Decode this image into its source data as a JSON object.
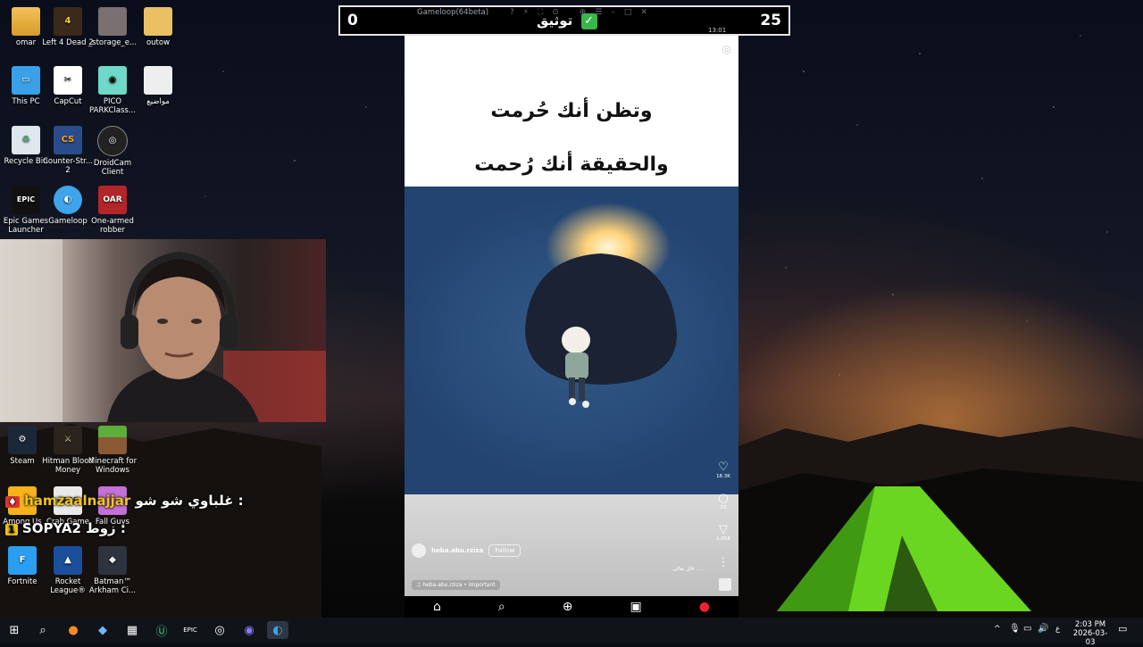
{
  "desktop": {
    "icons": [
      {
        "label": "omar"
      },
      {
        "label": "Left 4 Dead 2"
      },
      {
        "label": "_storage_e..."
      },
      {
        "label": "outow"
      },
      {
        "label": "This PC"
      },
      {
        "label": "CapCut"
      },
      {
        "label": "PICO PARKClass..."
      },
      {
        "label": "مواضيع"
      },
      {
        "label": "Recycle Bin"
      },
      {
        "label": "Counter-Str... 2"
      },
      {
        "label": "DroidCam Client"
      },
      {
        "label": "Epic Games Launcher"
      },
      {
        "label": "Gameloop"
      },
      {
        "label": "One-armed robber"
      },
      {
        "label": "Steam"
      },
      {
        "label": "Hitman Blood Money"
      },
      {
        "label": "Minecraft for Windows"
      },
      {
        "label": "Among Us"
      },
      {
        "label": "Crab Game"
      },
      {
        "label": "Fall Guys"
      },
      {
        "label": "Fortnite"
      },
      {
        "label": "Rocket League®"
      },
      {
        "label": "Batman™ Arkham Ci..."
      }
    ]
  },
  "chat": {
    "messages": [
      {
        "user": "hamzaalnajjar",
        "text": "غلباوي شو شو :"
      },
      {
        "user": "SOPYA2",
        "text": "زوط :"
      }
    ]
  },
  "overlay": {
    "score_left": "0",
    "score_right": "25",
    "center_text": "توثيق",
    "check": "✓",
    "emulator_title": "Gameloop(64beta)",
    "status_time": "13:01"
  },
  "post": {
    "caption_line1": "وتظن أنك حُرمت",
    "caption_line2": "والحقيقة أنك رُحمت",
    "likes": "18.3K",
    "comments": "33",
    "shares": "1,658",
    "username": "heba.abu.rziza",
    "follow_label": "Follow",
    "description": "قال تعالى : ...",
    "audio": "heba.abu.rziza • Important"
  },
  "taskbar": {
    "time": "2:03 PM",
    "date": "2026-03-03",
    "lang": "ع"
  }
}
